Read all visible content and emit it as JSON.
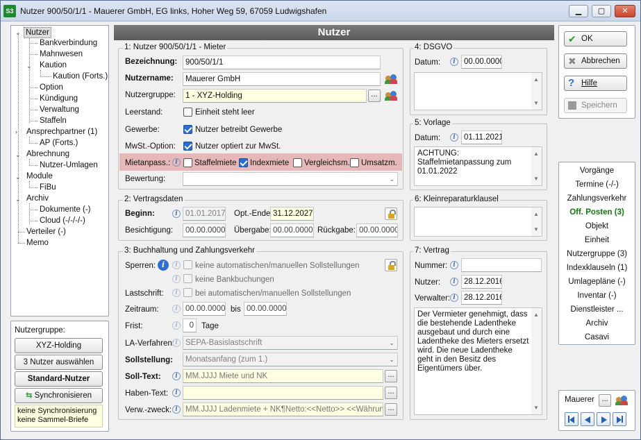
{
  "window": {
    "title": "Nutzer 900/50/1/1 - Mauerer GmbH, EG links, Hoher Weg 59, 67059 Ludwigshafen",
    "app_icon": "S3",
    "min": "▁",
    "max": "▢",
    "close": "✕"
  },
  "tree": {
    "items": [
      "Nutzer",
      "Bankverbindung",
      "Mahnwesen",
      "Kaution",
      "Kaution (Forts.)",
      "Option",
      "Kündigung",
      "Verwaltung",
      "Staffeln",
      "Ansprechpartner (1)",
      "AP (Forts.)",
      "Abrechnung",
      "Nutzer-Umlagen",
      "Module",
      "FiBu",
      "Archiv",
      "Dokumente (-)",
      "Cloud (-/-/-/-)",
      "Verteiler (-)",
      "Memo"
    ]
  },
  "nutzergruppe": {
    "label": "Nutzergruppe:",
    "group_button": "XYZ-Holding",
    "select_button": "3 Nutzer auswählen",
    "standard_button": "Standard-Nutzer",
    "sync_button": "Synchronisieren",
    "note_line1": "keine Synchronisierung",
    "note_line2": "keine Sammel-Briefe"
  },
  "header": {
    "title": "Nutzer"
  },
  "sec1": {
    "title": "1: Nutzer 900/50/1/1 - Mieter",
    "bez_label": "Bezeichnung:",
    "bez_value": "900/50/1/1",
    "name_label": "Nutzername:",
    "name_value": "Mauerer GmbH",
    "gruppe_label": "Nutzergruppe:",
    "gruppe_value": "1 - XYZ-Holding",
    "dots": "...",
    "leerstand_label": "Leerstand:",
    "leerstand_cb": "Einheit steht leer",
    "gewerbe_label": "Gewerbe:",
    "gewerbe_cb": "Nutzer betreibt Gewerbe",
    "mwst_label": "MwSt.-Option:",
    "mwst_cb": "Nutzer optiert zur MwSt.",
    "miet_label": "Mietanpass.:",
    "staffel": "Staffelmiete",
    "index": "Indexmiete",
    "vergleich": "Vergleichsm.",
    "umsatz": "Umsatzm.",
    "bewertung_label": "Bewertung:",
    "bewertung_value": ""
  },
  "sec2": {
    "title": "2: Vertragsdaten",
    "beginn_label": "Beginn:",
    "beginn_value": "01.01.2017",
    "optende_label": "Opt.-Ende:",
    "optende_value": "31.12.2027",
    "besicht_label": "Besichtigung:",
    "besicht_value": "00.00.0000",
    "uebergabe_label": "Übergabe:",
    "uebergabe_value": "00.00.0000",
    "rueckgabe_label": "Rückgabe:",
    "rueckgabe_value": "00.00.0000"
  },
  "sec3": {
    "title": "3: Buchhaltung und Zahlungsverkehr",
    "sperren_label": "Sperren:",
    "sperren_cb1": "keine automatischen/manuellen Sollstellungen",
    "sperren_cb2": "keine Bankbuchungen",
    "last_label": "Lastschrift:",
    "last_cb": "bei automatischen/manuellen Sollstellungen",
    "zeitraum_label": "Zeitraum:",
    "zeit_from": "00.00.0000",
    "bis": "bis",
    "zeit_to": "00.00.0000",
    "frist_label": "Frist:",
    "frist_value": "0",
    "tage": "Tage",
    "la_label": "LA-Verfahren:",
    "la_value": "SEPA-Basislastschrift",
    "soll_label": "Sollstellung:",
    "soll_value": "Monatsanfang (zum 1.)",
    "solltext_label": "Soll-Text:",
    "solltext_value": "MM.JJJJ Miete und NK",
    "haben_label": "Haben-Text:",
    "haben_value": "",
    "verw_label": "Verw.-zweck:",
    "verw_value": "MM.JJJJ Ladenmiete + NK¶Netto:<<Netto>> <<Währung>>"
  },
  "sec4": {
    "title": "4: DSGVO",
    "datum_label": "Datum:",
    "datum_value": "00.00.0000"
  },
  "sec5": {
    "title": "5: Vorlage",
    "datum_label": "Datum:",
    "datum_value": "01.11.2021",
    "text": "ACHTUNG:\nStaffelmietanpassung zum\n01.01.2022"
  },
  "sec6": {
    "title": "6: Kleinreparaturklausel"
  },
  "sec7": {
    "title": "7: Vertrag",
    "nummer_label": "Nummer:",
    "nummer_value": "",
    "nutzer_label": "Nutzer:",
    "nutzer_value": "28.12.2016",
    "verwalter_label": "Verwalter:",
    "verwalter_value": "28.12.2016",
    "text": "Der Vermieter genehmigt, dass die bestehende Ladentheke ausgebaut und durch eine Ladentheke des Mieters ersetzt wird. Die neue Ladentheke geht in den Besitz des Eigentümers über."
  },
  "actions": {
    "ok": "OK",
    "cancel": "Abbrechen",
    "help": "Hilfe",
    "save": "Speichern"
  },
  "links": [
    "Vorgänge",
    "Termine (-/-)",
    "Zahlungsverkehr",
    "Off. Posten (3)",
    "Objekt",
    "Einheit",
    "Nutzergruppe (3)",
    "Indexklauseln (1)",
    "Umlagepläne (-)",
    "Inventar (-)",
    "Dienstleister ...",
    "Archiv",
    "Casavi"
  ],
  "search": {
    "value": "Mauerer",
    "dots": "..."
  },
  "colors": {
    "header": "#6a6a6a",
    "highlight": "#e6b8b8",
    "accent": "#2a6ed4",
    "link_active": "#117a11"
  }
}
